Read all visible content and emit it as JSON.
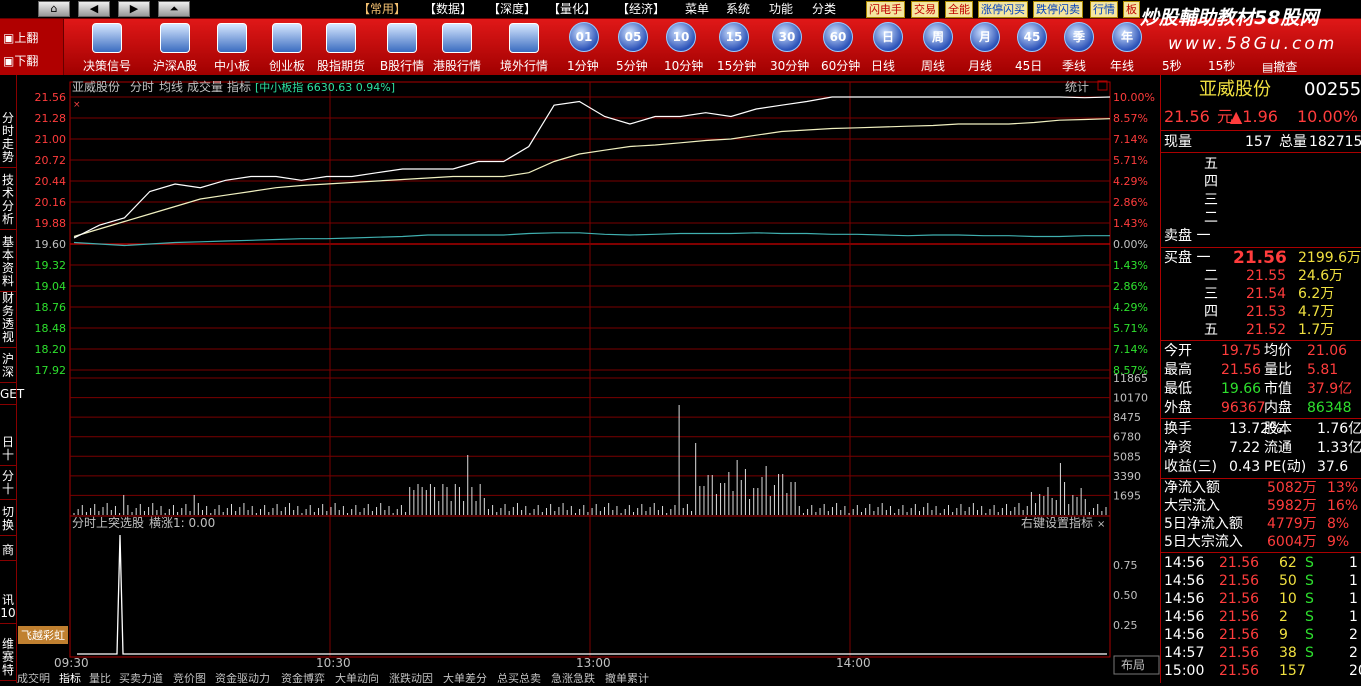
{
  "nav": {
    "home_icon": "home-icon",
    "back_icon": "back-arrow-icon",
    "fwd_icon": "forward-arrow-icon",
    "up_icon": "double-up-icon"
  },
  "menu": [
    {
      "label": "【常用】",
      "hl": true
    },
    {
      "label": "【数据】"
    },
    {
      "label": "【深度】"
    },
    {
      "label": "【量化】"
    },
    {
      "label": "【经济】"
    },
    {
      "label": "菜单"
    },
    {
      "label": "系统"
    },
    {
      "label": "功能"
    },
    {
      "label": "分类"
    }
  ],
  "menu_tabs": [
    {
      "label": "闪电手"
    },
    {
      "label": "交易"
    },
    {
      "label": "全能"
    },
    {
      "label": "涨停闪买",
      "blue": true
    },
    {
      "label": "跌停闪卖",
      "blue": true
    },
    {
      "label": "行情",
      "blue": true
    },
    {
      "label": "板"
    }
  ],
  "brand": {
    "title": "炒股輔助教材58股网",
    "url": "www.58Gu.com"
  },
  "pager": {
    "up": "上翻",
    "down": "下翻"
  },
  "tools": [
    {
      "label": "决策信号"
    },
    {
      "label": "沪深A股"
    },
    {
      "label": "中小板"
    },
    {
      "label": "创业板"
    },
    {
      "label": "股指期货"
    },
    {
      "label": "B股行情"
    },
    {
      "label": "港股行情"
    },
    {
      "label": "境外行情"
    }
  ],
  "periods": [
    {
      "icon": "01",
      "label": "1分钟"
    },
    {
      "icon": "05",
      "label": "5分钟"
    },
    {
      "icon": "10",
      "label": "10分钟"
    },
    {
      "icon": "15",
      "label": "15分钟"
    },
    {
      "icon": "30",
      "label": "30分钟"
    },
    {
      "icon": "60",
      "label": "60分钟"
    },
    {
      "icon": "日",
      "label": "日线"
    },
    {
      "icon": "周",
      "label": "周线"
    },
    {
      "icon": "月",
      "label": "月线"
    },
    {
      "icon": "45",
      "label": "45日"
    },
    {
      "icon": "季",
      "label": "季线"
    },
    {
      "icon": "年",
      "label": "年线"
    },
    {
      "icon": "",
      "label": "5秒"
    },
    {
      "icon": "",
      "label": "15秒"
    }
  ],
  "withdraw": "撤查",
  "left_tabs": [
    "分时走势",
    "技术分析",
    "基本资料",
    "财务透视",
    "沪深",
    "GET",
    "日十",
    "分十",
    "切换",
    "商",
    "讯10",
    "维赛特"
  ],
  "chart_header": {
    "name": "亚威股份",
    "t1": "分时",
    "t2": "均线",
    "t3": "成交量",
    "t4": "指标",
    "index": "[中小板指 6630.63 0.94%]",
    "stats": "统计"
  },
  "price_ticks": [
    "21.56",
    "21.28",
    "21.00",
    "20.72",
    "20.44",
    "20.16",
    "19.88",
    "19.60",
    "19.32",
    "19.04",
    "18.76",
    "18.48",
    "18.20",
    "17.92"
  ],
  "pct_ticks": [
    "10.00%",
    "8.57%",
    "7.14%",
    "5.71%",
    "4.29%",
    "2.86%",
    "1.43%",
    "0.00%",
    "1.43%",
    "2.86%",
    "4.29%",
    "5.71%",
    "7.14%",
    "8.57%"
  ],
  "vol_ticks": [
    "11865",
    "10170",
    "8475",
    "6780",
    "5085",
    "3390",
    "1695"
  ],
  "ind_header": {
    "name": "分时上突选股",
    "value": "横涨1: 0.00",
    "right": "右键设置指标"
  },
  "ind_ticks": [
    "0.75",
    "0.50",
    "0.25"
  ],
  "time_ticks": [
    "09:30",
    "10:30",
    "13:00",
    "14:00"
  ],
  "badge": "飞越彩虹",
  "layout_btn": "布局",
  "bottom_tabs": [
    "成交明",
    "指标",
    "量比",
    "买卖力道",
    "竞价图",
    "资金驱动力",
    "资金博弈",
    "大单动向",
    "涨跌动因",
    "大单差分",
    "总买总卖",
    "急涨急跌",
    "撤单累计"
  ],
  "chart_data": {
    "type": "line",
    "prev_close": 19.6,
    "ylim": [
      17.92,
      21.56
    ],
    "price": [
      19.68,
      19.85,
      19.95,
      20.3,
      20.4,
      20.35,
      20.45,
      20.5,
      20.5,
      20.45,
      20.5,
      20.5,
      20.55,
      20.6,
      20.6,
      20.6,
      20.7,
      20.7,
      20.9,
      21.45,
      21.5,
      21.3,
      21.2,
      21.3,
      21.3,
      21.35,
      21.3,
      21.4,
      21.45,
      21.5,
      21.56,
      21.56,
      21.56,
      21.56,
      21.56,
      21.56,
      21.56,
      21.56,
      21.56,
      21.56,
      21.55,
      21.56
    ],
    "avg": [
      19.7,
      19.8,
      19.9,
      20.0,
      20.1,
      20.2,
      20.25,
      20.3,
      20.35,
      20.38,
      20.4,
      20.42,
      20.44,
      20.46,
      20.48,
      20.5,
      20.5,
      20.5,
      20.55,
      20.7,
      20.8,
      20.85,
      20.9,
      20.92,
      20.95,
      20.98,
      21.0,
      21.05,
      21.1,
      21.12,
      21.14,
      21.15,
      21.16,
      21.17,
      21.18,
      21.2,
      21.2,
      21.2,
      21.22,
      21.25,
      21.26,
      21.27
    ],
    "index_line": [
      19.62,
      19.6,
      19.58,
      19.6,
      19.62,
      19.63,
      19.64,
      19.65,
      19.66,
      19.67,
      19.67,
      19.68,
      19.69,
      19.7,
      19.72,
      19.72,
      19.72,
      19.72,
      19.74,
      19.75,
      19.75,
      19.73,
      19.72,
      19.73,
      19.74,
      19.74,
      19.74,
      19.75,
      19.74,
      19.74,
      19.73,
      19.73,
      19.72,
      19.71,
      19.72,
      19.72,
      19.71,
      19.71,
      19.7,
      19.7,
      19.71,
      19.71
    ]
  },
  "quote": {
    "name": "亚威股份",
    "code": "002559",
    "price": "21.56",
    "unit": "元",
    "chg": "▲1.96",
    "pct": "10.00%",
    "now_label": "现量",
    "now": "157",
    "total_label": "总量",
    "total": "182715",
    "sell": [
      {
        "l": "五",
        "p": "",
        "v": ""
      },
      {
        "l": "四",
        "p": "",
        "v": ""
      },
      {
        "l": "三",
        "p": "",
        "v": ""
      },
      {
        "l": "二",
        "p": "",
        "v": ""
      },
      {
        "l": "卖盘 一",
        "p": "",
        "v": ""
      }
    ],
    "buy": [
      {
        "l": "买盘 一",
        "p": "21.56",
        "v": "2199.6万"
      },
      {
        "l": "二",
        "p": "21.55",
        "v": "24.6万"
      },
      {
        "l": "三",
        "p": "21.54",
        "v": "6.2万"
      },
      {
        "l": "四",
        "p": "21.53",
        "v": "4.7万"
      },
      {
        "l": "五",
        "p": "21.52",
        "v": "1.7万"
      }
    ],
    "stats": [
      [
        "今开",
        "19.75",
        "均价",
        "21.06"
      ],
      [
        "最高",
        "21.56",
        "量比",
        "5.81"
      ],
      [
        "最低",
        "19.66",
        "市值",
        "37.9亿"
      ],
      [
        "外盘",
        "96367",
        "内盘",
        "86348"
      ]
    ],
    "stats2": [
      [
        "换手",
        "13.72%",
        "股本",
        "1.76亿"
      ],
      [
        "净资",
        "7.22",
        "流通",
        "1.33亿"
      ],
      [
        "收益(三)",
        "0.43",
        "PE(动)",
        "37.6"
      ]
    ],
    "flows": [
      [
        "净流入额",
        "5082万",
        "13%"
      ],
      [
        "大宗流入",
        "5982万",
        "16%"
      ],
      [
        "5日净流入额",
        "4779万",
        "8%"
      ],
      [
        "5日大宗流入",
        "6004万",
        "9%"
      ]
    ],
    "ticks": [
      [
        "14:56",
        "21.56",
        "62",
        "S",
        "1"
      ],
      [
        "14:56",
        "21.56",
        "50",
        "S",
        "1"
      ],
      [
        "14:56",
        "21.56",
        "10",
        "S",
        "1"
      ],
      [
        "14:56",
        "21.56",
        "2",
        "S",
        "1"
      ],
      [
        "14:56",
        "21.56",
        "9",
        "S",
        "2"
      ],
      [
        "14:57",
        "21.56",
        "38",
        "S",
        "2"
      ],
      [
        "15:00",
        "21.56",
        "157",
        "",
        "20"
      ]
    ]
  }
}
